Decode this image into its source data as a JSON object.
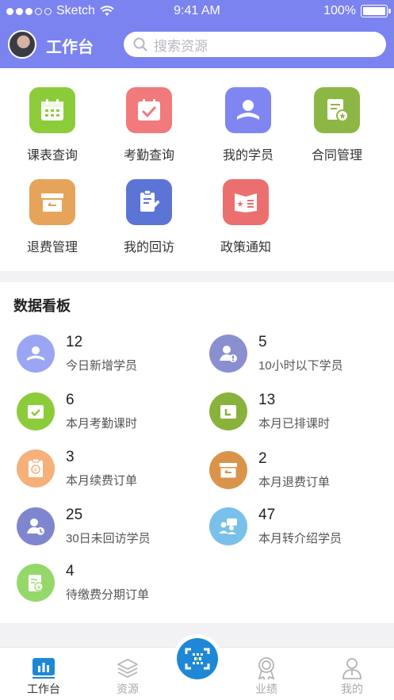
{
  "status_bar": {
    "carrier": "Sketch",
    "time": "9:41 AM",
    "battery": "100%"
  },
  "header": {
    "title": "工作台",
    "search_placeholder": "搜索资源"
  },
  "quick_entries": [
    {
      "label": "课表查询",
      "icon": "calendar-grid-icon",
      "color": "#8ccc3a"
    },
    {
      "label": "考勤查询",
      "icon": "calendar-check-icon",
      "color": "#f07a7c"
    },
    {
      "label": "我的学员",
      "icon": "student-icon",
      "color": "#7f86f2"
    },
    {
      "label": "合同管理",
      "icon": "contract-icon",
      "color": "#8db744"
    },
    {
      "label": "退费管理",
      "icon": "refund-box-icon",
      "color": "#e6a35a"
    },
    {
      "label": "我的回访",
      "icon": "visit-note-icon",
      "color": "#5c74d6"
    },
    {
      "label": "政策通知",
      "icon": "policy-notice-icon",
      "color": "#ec6f6f"
    }
  ],
  "dashboard": {
    "title": "数据看板",
    "stats": [
      {
        "value": "12",
        "label": "今日新增学员",
        "icon": "new-student-icon",
        "color": "#9aa6f3"
      },
      {
        "value": "5",
        "label": "10小时以下学员",
        "icon": "student-alert-icon",
        "color": "#8a8fcf"
      },
      {
        "value": "6",
        "label": "本月考勤课时",
        "icon": "attendance-icon",
        "color": "#8ccc3a"
      },
      {
        "value": "13",
        "label": "本月已排课时",
        "icon": "scheduled-icon",
        "color": "#89b23c"
      },
      {
        "value": "3",
        "label": "本月续费订单",
        "icon": "renewal-icon",
        "color": "#f6b07a"
      },
      {
        "value": "2",
        "label": "本月退费订单",
        "icon": "refund-order-icon",
        "color": "#d9944a"
      },
      {
        "value": "25",
        "label": "30日未回访学员",
        "icon": "no-visit-icon",
        "color": "#7f86cf"
      },
      {
        "value": "47",
        "label": "本月转介绍学员",
        "icon": "referral-icon",
        "color": "#79c0ea"
      },
      {
        "value": "4",
        "label": "待缴费分期订单",
        "icon": "installment-icon",
        "color": "#95d86a"
      }
    ]
  },
  "tabbar": {
    "items": [
      {
        "label": "工作台",
        "icon": "workbench-chart-icon",
        "active": true
      },
      {
        "label": "资源",
        "icon": "layers-icon",
        "active": false
      },
      {
        "label": "业绩",
        "icon": "medal-icon",
        "active": false
      },
      {
        "label": "我的",
        "icon": "person-icon",
        "active": false
      }
    ],
    "center_icon": "scan-icon"
  },
  "colors": {
    "header_bg": "#7b83f0",
    "scan_button": "#1e88d6"
  }
}
